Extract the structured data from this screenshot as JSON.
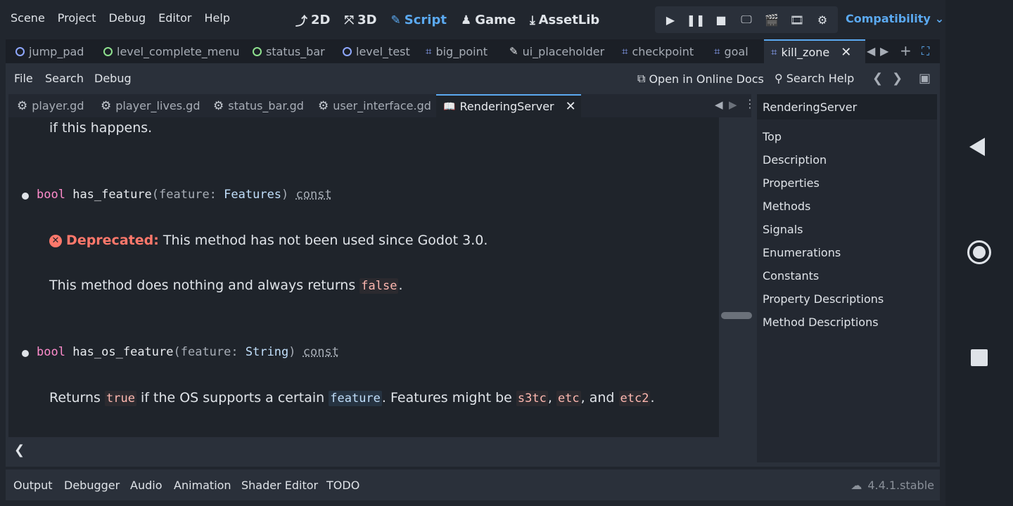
{
  "menubar": {
    "menus": [
      "Scene",
      "Project",
      "Debug",
      "Editor",
      "Help"
    ],
    "modes": [
      {
        "icon": "2d-icon",
        "glyph": "⤴",
        "label": "2D"
      },
      {
        "icon": "3d-icon",
        "glyph": "⤧",
        "label": "3D"
      },
      {
        "icon": "script-icon",
        "glyph": "✎",
        "label": "Script"
      },
      {
        "icon": "game-icon",
        "glyph": "♟",
        "label": "Game"
      },
      {
        "icon": "assetlib-icon",
        "glyph": "⤓",
        "label": "AssetLib"
      }
    ],
    "active_mode": "Script",
    "renderer": "Compatibility",
    "accent_color": "#5ba9f0"
  },
  "scene_tabs": [
    {
      "label": "jump_pad",
      "icon": "node-circle-icon"
    },
    {
      "label": "level_complete_menu",
      "icon": "control-circle-icon"
    },
    {
      "label": "status_bar",
      "icon": "control-circle-icon"
    },
    {
      "label": "level_test",
      "icon": "node-circle-icon"
    },
    {
      "label": "big_point",
      "icon": "area-icon"
    },
    {
      "label": "ui_placeholder",
      "icon": "edit-icon"
    },
    {
      "label": "checkpoint",
      "icon": "area-icon"
    },
    {
      "label": "goal",
      "icon": "area-icon"
    },
    {
      "label": "kill_zone",
      "icon": "area-icon"
    }
  ],
  "script_toolbar": {
    "file": "File",
    "search": "Search",
    "debug": "Debug",
    "online_docs": "Open in Online Docs",
    "search_help": "Search Help"
  },
  "script_tabs": [
    {
      "label": "player.gd"
    },
    {
      "label": "player_lives.gd"
    },
    {
      "label": "status_bar.gd"
    },
    {
      "label": "user_interface.gd"
    },
    {
      "label": "RenderingServer"
    }
  ],
  "doc": {
    "line_prev": "if this happens.",
    "m1_ret": "bool",
    "m1_name": "has_feature",
    "m1_open": "(feature: ",
    "m1_type": "Features",
    "m1_close": ")",
    "m1_const": "const",
    "deprecated_label": "Deprecated:",
    "deprecated_text": "This method has not been used since Godot 3.0.",
    "m1_desc_pre": "This method does nothing and always returns ",
    "m1_desc_code": "false",
    "m1_desc_post": ".",
    "m2_ret": "bool",
    "m2_name": "has_os_feature",
    "m2_open": "(feature: ",
    "m2_type": "String",
    "m2_close": ")",
    "m2_const": "const",
    "m2_desc_a": "Returns ",
    "m2_desc_b": "true",
    "m2_desc_c": " if the OS supports a certain ",
    "m2_desc_d": "feature",
    "m2_desc_e": ". Features might be ",
    "m2_desc_f": "s3tc",
    "m2_desc_g": ", ",
    "m2_desc_h": "etc",
    "m2_desc_i": ", and ",
    "m2_desc_j": "etc2",
    "m2_desc_k": "."
  },
  "sidebar": {
    "search_value": "RenderingServer",
    "items": [
      "Top",
      "Description",
      "Properties",
      "Methods",
      "Signals",
      "Enumerations",
      "Constants",
      "Property Descriptions",
      "Method Descriptions"
    ]
  },
  "bottom_bar": {
    "items": [
      "Output",
      "Debugger",
      "Audio",
      "Animation",
      "Shader Editor",
      "TODO"
    ],
    "version": "4.4.1.stable"
  }
}
